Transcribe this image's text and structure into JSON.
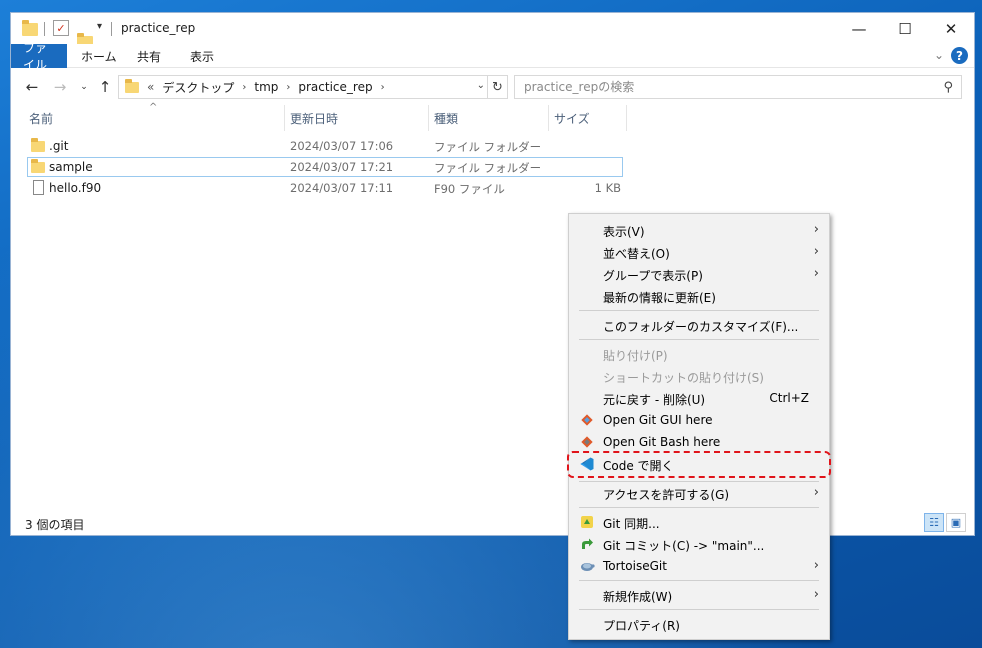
{
  "colors": {
    "accent": "#1a6bbf",
    "selection_border": "#99c9ef",
    "highlight": "#e0141a",
    "menu_bg": "#f2f2f2"
  },
  "window": {
    "title": "practice_rep",
    "controls": {
      "minimize": "—",
      "maximize": "☐",
      "close": "✕"
    }
  },
  "ribbon": {
    "tabs": [
      {
        "label": "ファイル"
      },
      {
        "label": "ホーム"
      },
      {
        "label": "共有"
      },
      {
        "label": "表示"
      }
    ]
  },
  "address": {
    "overflow": "«",
    "crumbs": [
      "デスクトップ",
      "tmp",
      "practice_rep"
    ],
    "search_placeholder": "practice_repの検索"
  },
  "columns": {
    "name": "名前",
    "date": "更新日時",
    "type": "種類",
    "size": "サイズ"
  },
  "files": [
    {
      "name": ".git",
      "date": "2024/03/07 17:06",
      "type": "ファイル フォルダー",
      "size": "",
      "icon": "folder-icon"
    },
    {
      "name": "sample",
      "date": "2024/03/07 17:21",
      "type": "ファイル フォルダー",
      "size": "",
      "icon": "folder-icon",
      "selected": true
    },
    {
      "name": "hello.f90",
      "date": "2024/03/07 17:11",
      "type": "F90 ファイル",
      "size": "1 KB",
      "icon": "file-icon"
    }
  ],
  "status": {
    "item_count": "3 個の項目"
  },
  "context_menu": {
    "items": [
      {
        "label": "表示(V)",
        "submenu": true
      },
      {
        "label": "並べ替え(O)",
        "submenu": true
      },
      {
        "label": "グループで表示(P)",
        "submenu": true
      },
      {
        "label": "最新の情報に更新(E)"
      },
      {
        "label": "このフォルダーのカスタマイズ(F)..."
      },
      {
        "label": "貼り付け(P)",
        "disabled": true
      },
      {
        "label": "ショートカットの貼り付け(S)",
        "disabled": true
      },
      {
        "label": "元に戻す - 削除(U)",
        "shortcut": "Ctrl+Z"
      },
      {
        "label": "Open Git GUI here",
        "icon": "git-gui-icon"
      },
      {
        "label": "Open Git Bash here",
        "icon": "git-bash-icon"
      },
      {
        "label": "Code で開く",
        "icon": "vscode-icon",
        "highlighted": true
      },
      {
        "label": "アクセスを許可する(G)",
        "submenu": true
      },
      {
        "label": "Git 同期...",
        "icon": "git-sync-icon"
      },
      {
        "label": "Git コミット(C) -> \"main\"...",
        "icon": "git-commit-icon"
      },
      {
        "label": "TortoiseGit",
        "icon": "tortoisegit-icon",
        "submenu": true
      },
      {
        "label": "新規作成(W)",
        "submenu": true
      },
      {
        "label": "プロパティ(R)"
      }
    ]
  }
}
